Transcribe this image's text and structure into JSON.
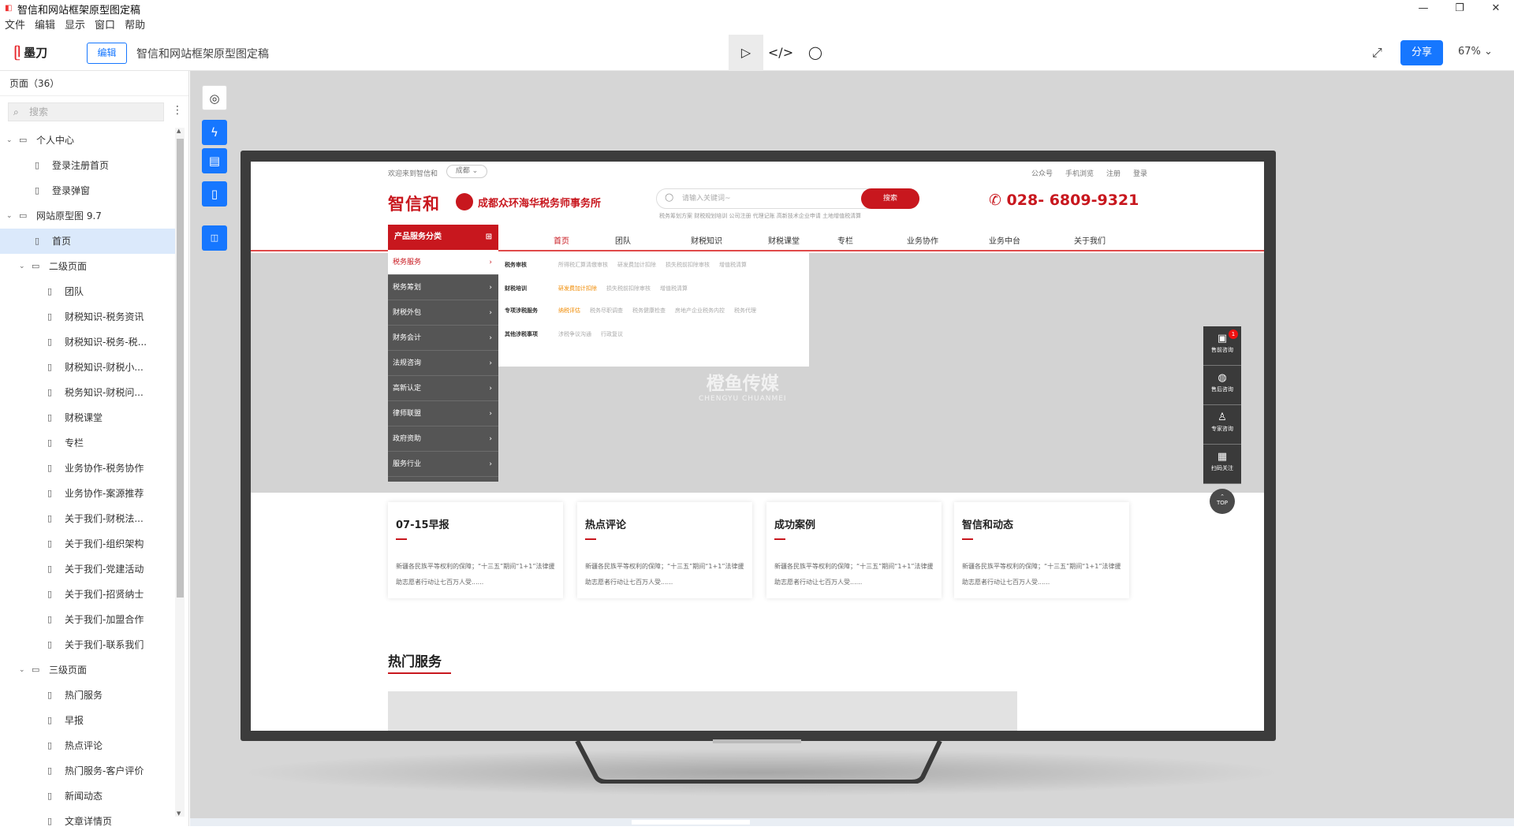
{
  "window": {
    "title": "智信和网站框架原型图定稿",
    "controls": [
      "—",
      "❐",
      "✕"
    ]
  },
  "menu": [
    "文件",
    "编辑",
    "显示",
    "窗口",
    "帮助"
  ],
  "toolbar": {
    "brand": "墨刀",
    "edit_label": "编辑",
    "doc_title": "智信和网站框架原型图定稿",
    "share_label": "分享",
    "zoom": "67%"
  },
  "sidebar": {
    "header": "页面（36）",
    "search_placeholder": "搜索",
    "items": [
      {
        "label": "个人中心",
        "level": 0,
        "type": "folder"
      },
      {
        "label": "登录注册首页",
        "level": 1,
        "type": "page"
      },
      {
        "label": "登录弹窗",
        "level": 1,
        "type": "page"
      },
      {
        "label": "网站原型图 9.7",
        "level": 0,
        "type": "folder"
      },
      {
        "label": "首页",
        "level": 1,
        "type": "page",
        "selected": true
      },
      {
        "label": "二级页面",
        "level": 1,
        "type": "folder"
      },
      {
        "label": "团队",
        "level": 2,
        "type": "page"
      },
      {
        "label": "财税知识-税务资讯",
        "level": 2,
        "type": "page"
      },
      {
        "label": "财税知识-税务-税...",
        "level": 2,
        "type": "page"
      },
      {
        "label": "财税知识-财税小...",
        "level": 2,
        "type": "page"
      },
      {
        "label": "税务知识-财税问...",
        "level": 2,
        "type": "page"
      },
      {
        "label": "财税课堂",
        "level": 2,
        "type": "page"
      },
      {
        "label": "专栏",
        "level": 2,
        "type": "page"
      },
      {
        "label": "业务协作-税务协作",
        "level": 2,
        "type": "page"
      },
      {
        "label": "业务协作-案源推荐",
        "level": 2,
        "type": "page"
      },
      {
        "label": "关于我们-财税法...",
        "level": 2,
        "type": "page"
      },
      {
        "label": "关于我们-组织架构",
        "level": 2,
        "type": "page"
      },
      {
        "label": "关于我们-党建活动",
        "level": 2,
        "type": "page"
      },
      {
        "label": "关于我们-招贤纳士",
        "level": 2,
        "type": "page"
      },
      {
        "label": "关于我们-加盟合作",
        "level": 2,
        "type": "page"
      },
      {
        "label": "关于我们-联系我们",
        "level": 2,
        "type": "page"
      },
      {
        "label": "三级页面",
        "level": 1,
        "type": "folder"
      },
      {
        "label": "热门服务",
        "level": 2,
        "type": "page"
      },
      {
        "label": "早报",
        "level": 2,
        "type": "page"
      },
      {
        "label": "热点评论",
        "level": 2,
        "type": "page"
      },
      {
        "label": "热门服务-客户评价",
        "level": 2,
        "type": "page"
      },
      {
        "label": "新闻动态",
        "level": 2,
        "type": "page"
      },
      {
        "label": "文章详情页",
        "level": 2,
        "type": "page"
      }
    ]
  },
  "site": {
    "welcome": "欢迎来到智信和",
    "city": "成都 ⌄",
    "top_links": [
      "公众号",
      "手机浏览",
      "注册",
      "登录"
    ],
    "logo_main": "智信和",
    "logo_firm": "成都众环海华税务师事务所",
    "search_placeholder": "请输入关键词~",
    "search_btn": "搜索",
    "hot_words": "税务筹划方案   财税规划培训   公司注册   代理记账   高新技术企业申请   土地增值税清算",
    "phone": "028- 6809-9321",
    "category_title": "产品服务分类",
    "nav": [
      "首页",
      "团队",
      "财税知识",
      "财税课堂",
      "专栏",
      "业务协作",
      "业务中台",
      "关于我们"
    ],
    "side_menu": [
      "税务服务",
      "税务筹划",
      "财税外包",
      "财务会计",
      "法规咨询",
      "高新认定",
      "律师联盟",
      "政府资助",
      "服务行业"
    ],
    "dropdown": [
      {
        "head": "税务审核",
        "items": [
          "所得税汇算清缴审核",
          "研发费加计扣除",
          "损失税前扣除审核",
          "增值税清算"
        ]
      },
      {
        "head": "财税培训",
        "items": [
          "研发费加计扣除",
          "损失税前扣除审核",
          "增值税清算"
        ],
        "highlight": 0
      },
      {
        "head": "专项涉税服务",
        "items": [
          "纳税评估",
          "税务尽职调查",
          "税务健康检查",
          "房地产企业税务内控",
          "税务代理"
        ],
        "highlight": 0
      },
      {
        "head": "其他涉税事项",
        "items": [
          "涉税争议沟通",
          "行政复议"
        ]
      }
    ],
    "watermark": "橙鱼传媒",
    "watermark_en": "CHENGYU CHUANMEI",
    "float_buttons": [
      "售前咨询",
      "售后咨询",
      "专家咨询",
      "扫码关注"
    ],
    "badge": "1",
    "top_btn": "TOP",
    "cards": [
      {
        "title": "07-15早报",
        "text": "新疆各民族平等权利的保障；“十三五”期间“1+1”法律援助志愿者行动让七百万人受......"
      },
      {
        "title": "热点评论",
        "text": "新疆各民族平等权利的保障；“十三五”期间“1+1”法律援助志愿者行动让七百万人受......"
      },
      {
        "title": "成功案例",
        "text": "新疆各民族平等权利的保障；“十三五”期间“1+1”法律援助志愿者行动让七百万人受......"
      },
      {
        "title": "智信和动态",
        "text": "新疆各民族平等权利的保障；“十三五”期间“1+1”法律援助志愿者行动让七百万人受......"
      }
    ],
    "hot_services": "热门服务"
  }
}
